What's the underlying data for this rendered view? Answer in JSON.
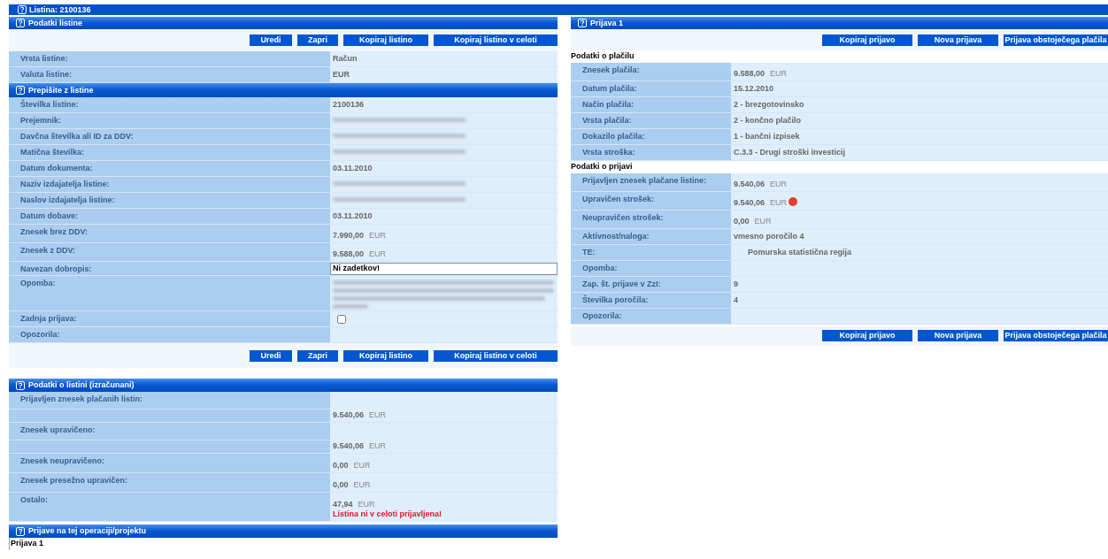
{
  "top_bar": {
    "title": "Listina: 2100136"
  },
  "document_panel": {
    "title": "Podatki listine",
    "buttons": [
      "Uredi",
      "Zapri",
      "Kopiraj listino",
      "Kopiraj listino v celoti"
    ],
    "rows": [
      {
        "label": "Vrsta listine:",
        "kind": "text",
        "value": "Račun"
      },
      {
        "label": "Valuta listine:",
        "kind": "text",
        "value": "EUR"
      }
    ],
    "subsection": {
      "title": "Prepišite z listine",
      "rows": [
        {
          "label": "Številka listine:",
          "kind": "text",
          "value": "2100136"
        },
        {
          "label": "Prejemnik:",
          "kind": "redacted"
        },
        {
          "label": "Davčna številka ali ID za DDV:",
          "kind": "redacted"
        },
        {
          "label": "Matična številka:",
          "kind": "redacted"
        },
        {
          "label": "Datum dokumenta:",
          "kind": "text",
          "value": "03.11.2010"
        },
        {
          "label": "Naziv izdajatelja listine:",
          "kind": "redacted"
        },
        {
          "label": "Naslov izdajatelja listine:",
          "kind": "redacted"
        },
        {
          "label": "Datum dobave:",
          "kind": "text",
          "value": "03.11.2010"
        },
        {
          "label": "Znesek brez DDV:",
          "kind": "amount",
          "value": "7.990,00",
          "unit": "EUR"
        },
        {
          "label": "Znesek z DDV:",
          "kind": "amount",
          "value": "9.588,00",
          "unit": "EUR"
        },
        {
          "label": "Navezan dobropis:",
          "kind": "field",
          "value": "Ni zadetkov!"
        },
        {
          "label": "Opomba:",
          "kind": "redacted_paragraph"
        },
        {
          "label": "Zadnja prijava:",
          "kind": "checkbox",
          "checked": false
        },
        {
          "label": "Opozorila:",
          "kind": "empty"
        }
      ]
    },
    "bottom_buttons": [
      "Uredi",
      "Zapri",
      "Kopiraj listino",
      "Kopiraj listino v celoti"
    ]
  },
  "calculated_panel": {
    "title": "Podatki o listini (izračunani)",
    "rows": [
      {
        "label": "Prijavljen znesek plačanih listin:",
        "kind": "amount",
        "value": "9.540,06",
        "unit": "EUR",
        "spacer": true
      },
      {
        "label": "Znesek upravičeno:",
        "kind": "amount",
        "value": "9.540,06",
        "unit": "EUR",
        "spacer": true
      },
      {
        "label": "Znesek neupravičeno:",
        "kind": "amount",
        "value": "0,00",
        "unit": "EUR",
        "spacer": false
      },
      {
        "label": "Znesek presežno upravičen:",
        "kind": "amount",
        "value": "0,00",
        "unit": "EUR",
        "spacer": false
      },
      {
        "label": "Ostalo:",
        "kind": "amount",
        "value": "47,94",
        "unit": "EUR",
        "spacer": false,
        "note": "Listina ni v celoti prijavljena!"
      }
    ]
  },
  "claims_panel": {
    "title": "Prijave na tej operaciji/projektu",
    "items": [
      "Prijava 1"
    ]
  },
  "claim_panel": {
    "title": "Prijava 1",
    "buttons": [
      "Kopiraj prijavo",
      "Nova prijava",
      "Prijava obstoječega plačila"
    ],
    "groups": [
      {
        "heading": "Podatki o plačilu",
        "rows": [
          {
            "label": "Znesek plačila:",
            "kind": "amount",
            "value": "9.588,00",
            "unit": "EUR"
          },
          {
            "label": "Datum plačila:",
            "kind": "text",
            "value": "15.12.2010"
          },
          {
            "label": "Način plačila:",
            "kind": "text",
            "value": "2 - brezgotovinsko"
          },
          {
            "label": "Vrsta plačila:",
            "kind": "text",
            "value": "2 - končno plačilo"
          },
          {
            "label": "Dokazilo plačila:",
            "kind": "text",
            "value": "1 - bančni izpisek"
          },
          {
            "label": "Vrsta stroška:",
            "kind": "text",
            "value": "C.3.3 - Drugi stroški investicij"
          }
        ]
      },
      {
        "heading": "Podatki o prijavi",
        "rows": [
          {
            "label": "Prijavljen znesek plačane listine:",
            "kind": "amount",
            "value": "9.540,06",
            "unit": "EUR",
            "warning": false
          },
          {
            "label": "Upravičen strošek:",
            "kind": "amount",
            "value": "9.540,06",
            "unit": "EUR",
            "warning": true
          },
          {
            "label": "Neupravičen strošek:",
            "kind": "amount",
            "value": "0,00",
            "unit": "EUR",
            "warning": false
          },
          {
            "label": "Aktivnost/naloga:",
            "kind": "text",
            "value": "vmesno poročilo 4"
          },
          {
            "label": "TE:",
            "kind": "indented",
            "value": "Pomurska statistična regija"
          },
          {
            "label": "Opomba:",
            "kind": "empty"
          },
          {
            "label": "Zap. št. prijave v ZzI:",
            "kind": "text",
            "value": "9"
          },
          {
            "label": "Številka poročila:",
            "kind": "text",
            "value": "4"
          },
          {
            "label": "Opozorila:",
            "kind": "empty"
          }
        ]
      }
    ],
    "bottom_buttons": [
      "Kopiraj prijavo",
      "Nova prijava",
      "Prijava obstoječega plačila"
    ]
  }
}
